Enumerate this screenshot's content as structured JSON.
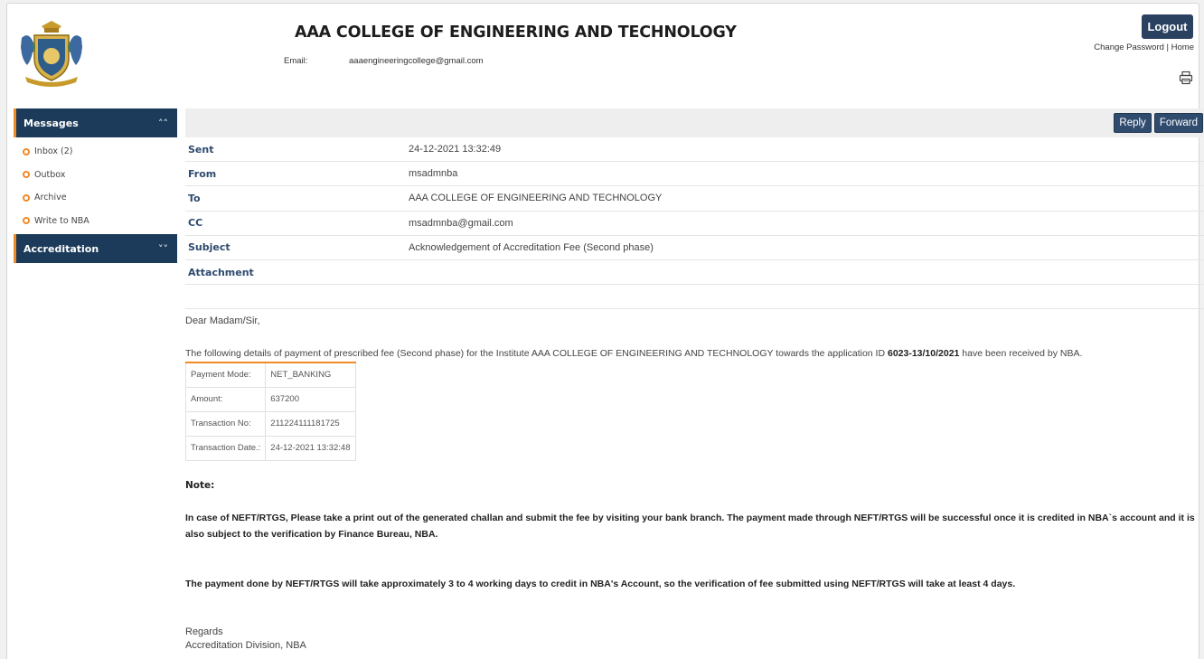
{
  "header": {
    "college_name": "AAA COLLEGE OF ENGINEERING AND TECHNOLOGY",
    "email_label": "Email:",
    "email_value": "aaaengineeringcollege@gmail.com",
    "logout_label": "Logout",
    "change_password_label": "Change Password",
    "separator": "|",
    "home_label": "Home"
  },
  "sidebar": {
    "messages_label": "Messages",
    "items": [
      {
        "label": "Inbox (2)"
      },
      {
        "label": "Outbox"
      },
      {
        "label": "Archive"
      },
      {
        "label": "Write to NBA"
      }
    ],
    "accreditation_label": "Accreditation"
  },
  "toolbar": {
    "reply_label": "Reply",
    "forward_label": "Forward"
  },
  "message": {
    "meta": [
      {
        "label": "Sent",
        "value": "24-12-2021 13:32:49"
      },
      {
        "label": "From",
        "value": "msadmnba"
      },
      {
        "label": "To",
        "value": "AAA COLLEGE OF ENGINEERING AND TECHNOLOGY"
      },
      {
        "label": "CC",
        "value": "msadmnba@gmail.com"
      },
      {
        "label": "Subject",
        "value": "Acknowledgement of Accreditation Fee (Second phase)"
      },
      {
        "label": "Attachment",
        "value": ""
      }
    ],
    "greeting": "Dear Madam/Sir,",
    "para1_prefix": "The following details of payment of prescribed fee (Second phase) for the Institute AAA COLLEGE OF ENGINEERING AND TECHNOLOGY towards the application ID ",
    "application_id": "6023-13/10/2021",
    "para1_suffix": " have been received by NBA.",
    "payment": [
      {
        "key": "Payment Mode:",
        "value": "NET_BANKING"
      },
      {
        "key": "Amount:",
        "value": "637200"
      },
      {
        "key": "Transaction No:",
        "value": "211224111181725"
      },
      {
        "key": "Transaction Date.:",
        "value": "24-12-2021 13:32:48"
      }
    ],
    "note_label": "Note:",
    "para2": "In case of NEFT/RTGS, Please take a print out of the generated challan and submit the fee by visiting your bank branch. The payment made through NEFT/RTGS will be successful once it is credited in NBA`s account and it is also subject to the verification by Finance Bureau, NBA.",
    "para3": "The payment done by NEFT/RTGS will take approximately 3 to 4 working days to credit in NBA's Account, so the verification of fee submitted using NEFT/RTGS will take at least 4 days.",
    "regards": "Regards",
    "signature": "Accreditation Division, NBA"
  },
  "colors": {
    "navy": "#1c3b5a",
    "button": "#2f4b6e",
    "accent_orange": "#f08a24",
    "label_blue": "#2d4a6e"
  },
  "icons": {
    "logo": "college-crest-logo",
    "print": "printer-icon",
    "collapse": "double-chevron-up-icon",
    "expand": "double-chevron-down-icon",
    "bullet": "ring-bullet-icon"
  }
}
